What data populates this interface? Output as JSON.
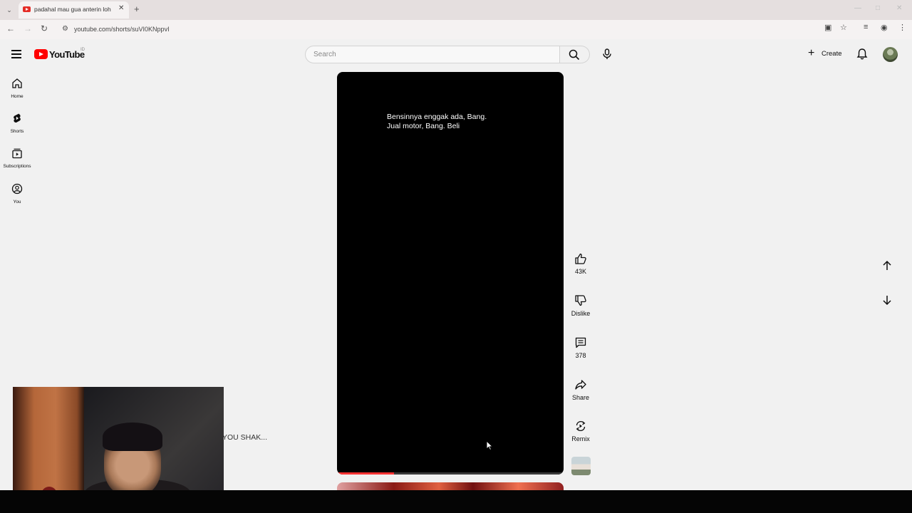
{
  "browser": {
    "tab_title": "padahal mau gua anterin loh -",
    "url": "youtube.com/shorts/suVI0KNppvI"
  },
  "header": {
    "logo_text": "YouTube",
    "country_code": "ID",
    "search_placeholder": "Search",
    "create_label": "Create"
  },
  "sidebar": {
    "items": [
      {
        "label": "Home",
        "icon": "home-icon"
      },
      {
        "label": "Shorts",
        "icon": "shorts-icon"
      },
      {
        "label": "Subscriptions",
        "icon": "subscriptions-icon"
      },
      {
        "label": "You",
        "icon": "you-icon"
      }
    ]
  },
  "short": {
    "caption_line1": "Bensinnya enggak ada, Bang.",
    "caption_line2": "Jual motor, Bang. Beli",
    "progress": 0.25
  },
  "actions": {
    "like_label": "43K",
    "dislike_label": "Dislike",
    "comments_label": "378",
    "share_label": "Share",
    "remix_label": "Remix"
  },
  "overlay": {
    "partial_text": "YOU SHAK..."
  },
  "colors": {
    "brand_red": "#ff0000",
    "progress_red": "#ff3333",
    "page_bg": "#f1f1f1"
  }
}
